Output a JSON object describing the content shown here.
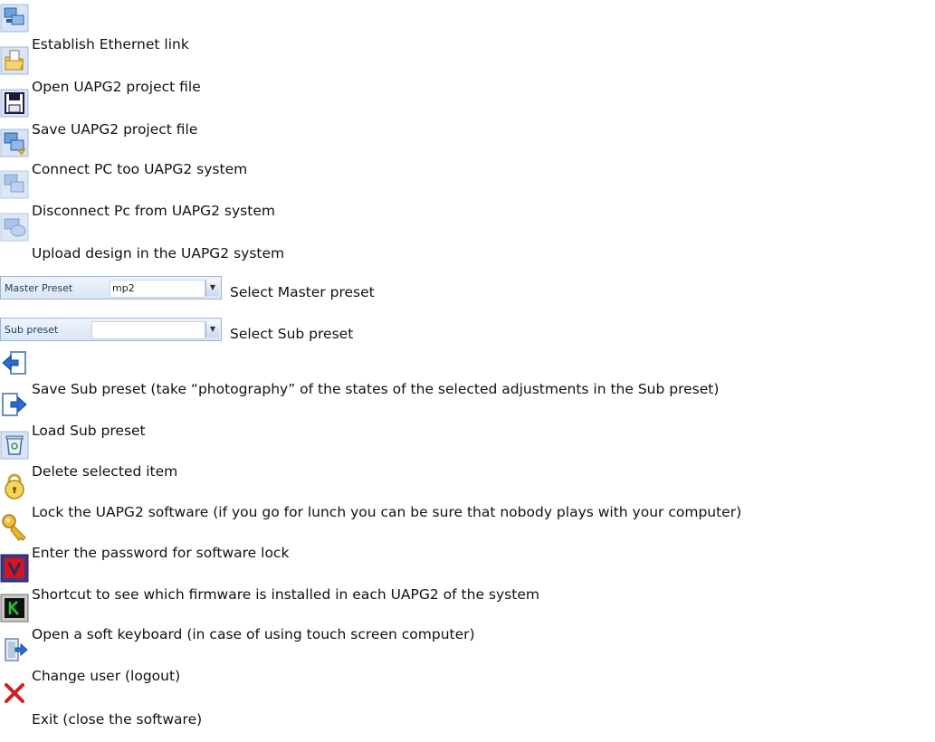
{
  "items": [
    {
      "icon": "ethernet-link-icon",
      "label": "Establish Ethernet link"
    },
    {
      "icon": "open-folder-icon",
      "label": "Open UAPG2 project file"
    },
    {
      "icon": "floppy-disk-icon",
      "label": "Save UAPG2 project file"
    },
    {
      "icon": "connect-icon",
      "label": "Connect PC too UAPG2 system"
    },
    {
      "icon": "disconnect-icon",
      "label": "Disconnect Pc from UAPG2 system"
    },
    {
      "icon": "upload-icon",
      "label": "Upload design in the UAPG2 system"
    },
    {
      "icon": "master-preset-combo",
      "label": "Select Master preset"
    },
    {
      "icon": "sub-preset-combo",
      "label": "Select Sub preset"
    },
    {
      "icon": "save-sub-preset-icon",
      "label": "Save Sub preset (take “photography” of the states of the selected adjustments in the Sub preset)"
    },
    {
      "icon": "load-sub-preset-icon",
      "label": "Load Sub preset"
    },
    {
      "icon": "trash-icon",
      "label": "Delete selected item"
    },
    {
      "icon": "lock-icon",
      "label": "Lock the UAPG2 software (if you go for lunch you can be sure that nobody plays with your computer)"
    },
    {
      "icon": "key-icon",
      "label": "Enter the password for software lock"
    },
    {
      "icon": "firmware-icon",
      "label": "Shortcut to see which firmware is installed in each UAPG2 of the system"
    },
    {
      "icon": "keyboard-icon",
      "label": "Open a soft keyboard (in case of using touch screen computer)"
    },
    {
      "icon": "logout-icon",
      "label": "Change user (logout)"
    },
    {
      "icon": "exit-icon",
      "label": "Exit (close the software)"
    }
  ],
  "master_preset": {
    "caption": "Master Preset",
    "value": "mp2"
  },
  "sub_preset": {
    "caption": "Sub preset",
    "value": ""
  }
}
